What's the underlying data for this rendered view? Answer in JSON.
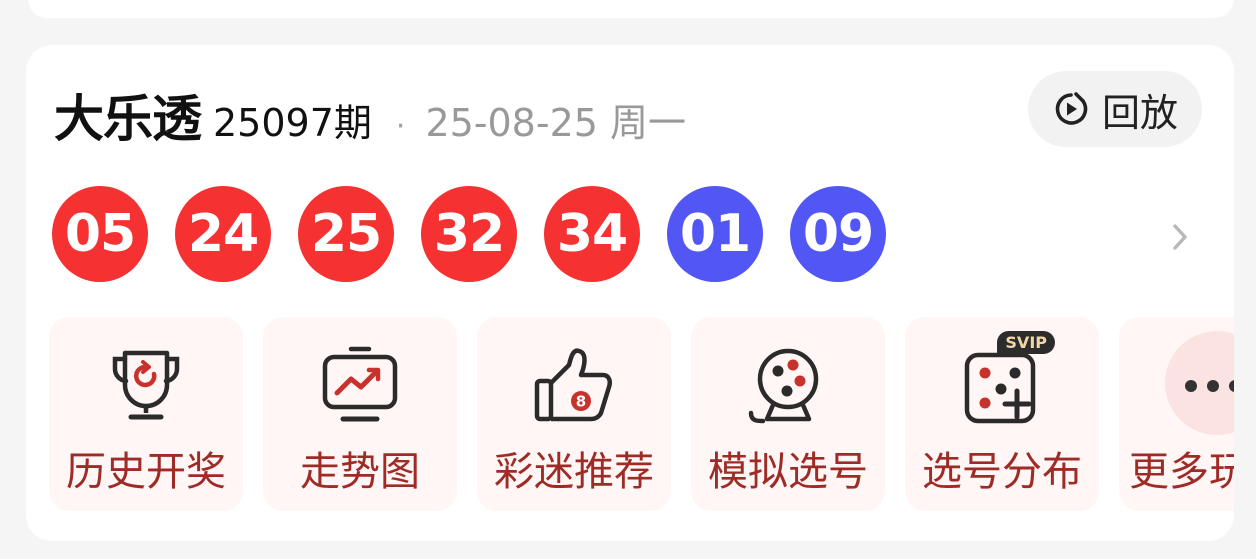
{
  "lottery": {
    "name": "大乐透",
    "issue": "25097期",
    "separator": "·",
    "date": "25-08-25 周一"
  },
  "replay": {
    "label": "回放",
    "icon": "replay-icon"
  },
  "balls": {
    "front": [
      "05",
      "24",
      "25",
      "32",
      "34"
    ],
    "back": [
      "01",
      "09"
    ],
    "front_color": "#f53131",
    "back_color": "#5156f5"
  },
  "tiles": [
    {
      "label": "历史开奖",
      "icon": "trophy-icon"
    },
    {
      "label": "走势图",
      "icon": "trend-chart-icon"
    },
    {
      "label": "彩迷推荐",
      "icon": "thumbs-up-icon"
    },
    {
      "label": "模拟选号",
      "icon": "lottery-machine-icon"
    },
    {
      "label": "选号分布",
      "icon": "dice-icon",
      "badge": "SVIP"
    },
    {
      "label": "更多玩",
      "icon": "more-icon"
    }
  ],
  "colors": {
    "tile_bg": "#fff6f5",
    "tile_text": "#9e2b25",
    "accent_red": "#c8322c"
  }
}
